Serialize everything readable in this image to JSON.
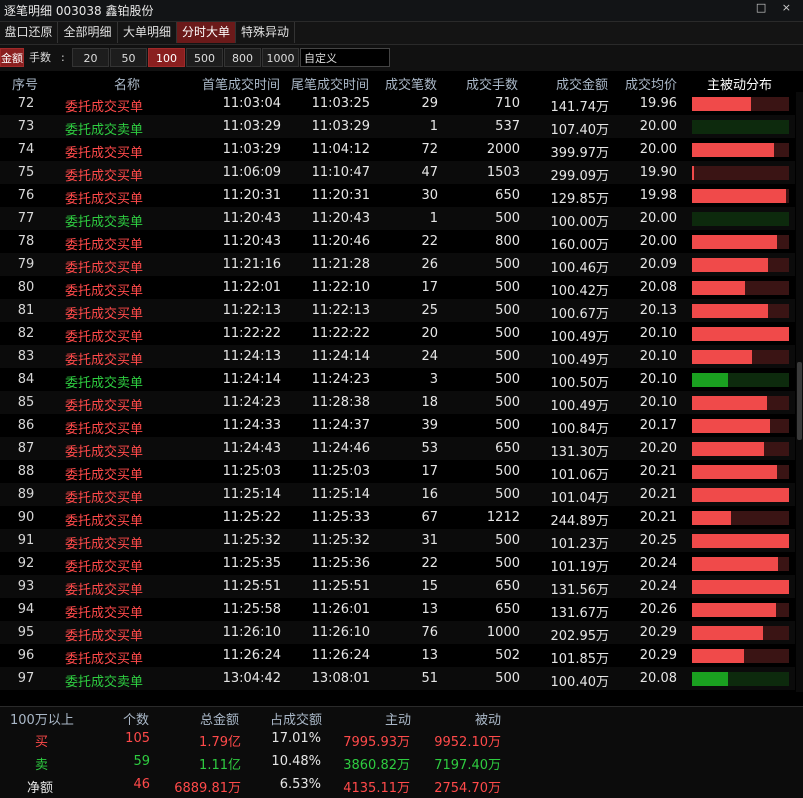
{
  "window": {
    "title": "逐笔明细 003038 鑫铂股份",
    "controls": "□ ×"
  },
  "tabs": [
    {
      "label": "盘口还原",
      "active": false
    },
    {
      "label": "全部明细",
      "active": false
    },
    {
      "label": "大单明细",
      "active": false
    },
    {
      "label": "分时大单",
      "active": true
    },
    {
      "label": "特殊异动",
      "active": false
    }
  ],
  "filter": {
    "amount_label": "金额",
    "lots_label": "手数",
    "colon": ":",
    "options": [
      "20",
      "50",
      "100",
      "500",
      "800",
      "1000"
    ],
    "selected": "100",
    "custom_value": "自定义"
  },
  "table": {
    "headers": {
      "no": "序号",
      "name": "名称",
      "first_time": "首笔成交时间",
      "last_time": "尾笔成交时间",
      "count": "成交笔数",
      "volume": "成交手数",
      "amount": "成交金额",
      "avg_price": "成交均价",
      "distribution": "主被动分布"
    },
    "rows": [
      {
        "no": "72",
        "name": "委托成交买单",
        "side": "buy",
        "first": "11:03:04",
        "last": "11:03:25",
        "count": "29",
        "vol": "710",
        "amt": "141.74万",
        "avg": "19.96",
        "active": 0.61
      },
      {
        "no": "73",
        "name": "委托成交卖单",
        "side": "sell",
        "first": "11:03:29",
        "last": "11:03:29",
        "count": "1",
        "vol": "537",
        "amt": "107.40万",
        "avg": "20.00",
        "active": 0.0
      },
      {
        "no": "74",
        "name": "委托成交买单",
        "side": "buy",
        "first": "11:03:29",
        "last": "11:04:12",
        "count": "72",
        "vol": "2000",
        "amt": "399.97万",
        "avg": "20.00",
        "active": 0.85
      },
      {
        "no": "75",
        "name": "委托成交买单",
        "side": "buy",
        "first": "11:06:09",
        "last": "11:10:47",
        "count": "47",
        "vol": "1503",
        "amt": "299.09万",
        "avg": "19.90",
        "active": 0.02
      },
      {
        "no": "76",
        "name": "委托成交买单",
        "side": "buy",
        "first": "11:20:31",
        "last": "11:20:31",
        "count": "30",
        "vol": "650",
        "amt": "129.85万",
        "avg": "19.98",
        "active": 0.97
      },
      {
        "no": "77",
        "name": "委托成交卖单",
        "side": "sell",
        "first": "11:20:43",
        "last": "11:20:43",
        "count": "1",
        "vol": "500",
        "amt": "100.00万",
        "avg": "20.00",
        "active": 0.0
      },
      {
        "no": "78",
        "name": "委托成交买单",
        "side": "buy",
        "first": "11:20:43",
        "last": "11:20:46",
        "count": "22",
        "vol": "800",
        "amt": "160.00万",
        "avg": "20.00",
        "active": 0.88
      },
      {
        "no": "79",
        "name": "委托成交买单",
        "side": "buy",
        "first": "11:21:16",
        "last": "11:21:28",
        "count": "26",
        "vol": "500",
        "amt": "100.46万",
        "avg": "20.09",
        "active": 0.78
      },
      {
        "no": "80",
        "name": "委托成交买单",
        "side": "buy",
        "first": "11:22:01",
        "last": "11:22:10",
        "count": "17",
        "vol": "500",
        "amt": "100.42万",
        "avg": "20.08",
        "active": 0.55
      },
      {
        "no": "81",
        "name": "委托成交买单",
        "side": "buy",
        "first": "11:22:13",
        "last": "11:22:13",
        "count": "25",
        "vol": "500",
        "amt": "100.67万",
        "avg": "20.13",
        "active": 0.78
      },
      {
        "no": "82",
        "name": "委托成交买单",
        "side": "buy",
        "first": "11:22:22",
        "last": "11:22:22",
        "count": "20",
        "vol": "500",
        "amt": "100.49万",
        "avg": "20.10",
        "active": 1.0
      },
      {
        "no": "83",
        "name": "委托成交买单",
        "side": "buy",
        "first": "11:24:13",
        "last": "11:24:14",
        "count": "24",
        "vol": "500",
        "amt": "100.49万",
        "avg": "20.10",
        "active": 0.62
      },
      {
        "no": "84",
        "name": "委托成交卖单",
        "side": "sell",
        "first": "11:24:14",
        "last": "11:24:23",
        "count": "3",
        "vol": "500",
        "amt": "100.50万",
        "avg": "20.10",
        "active": 0.37
      },
      {
        "no": "85",
        "name": "委托成交买单",
        "side": "buy",
        "first": "11:24:23",
        "last": "11:28:38",
        "count": "18",
        "vol": "500",
        "amt": "100.49万",
        "avg": "20.10",
        "active": 0.77
      },
      {
        "no": "86",
        "name": "委托成交买单",
        "side": "buy",
        "first": "11:24:33",
        "last": "11:24:37",
        "count": "39",
        "vol": "500",
        "amt": "100.84万",
        "avg": "20.17",
        "active": 0.8
      },
      {
        "no": "87",
        "name": "委托成交买单",
        "side": "buy",
        "first": "11:24:43",
        "last": "11:24:46",
        "count": "53",
        "vol": "650",
        "amt": "131.30万",
        "avg": "20.20",
        "active": 0.74
      },
      {
        "no": "88",
        "name": "委托成交买单",
        "side": "buy",
        "first": "11:25:03",
        "last": "11:25:03",
        "count": "17",
        "vol": "500",
        "amt": "101.06万",
        "avg": "20.21",
        "active": 0.88
      },
      {
        "no": "89",
        "name": "委托成交买单",
        "side": "buy",
        "first": "11:25:14",
        "last": "11:25:14",
        "count": "16",
        "vol": "500",
        "amt": "101.04万",
        "avg": "20.21",
        "active": 1.0
      },
      {
        "no": "90",
        "name": "委托成交买单",
        "side": "buy",
        "first": "11:25:22",
        "last": "11:25:33",
        "count": "67",
        "vol": "1212",
        "amt": "244.89万",
        "avg": "20.21",
        "active": 0.4
      },
      {
        "no": "91",
        "name": "委托成交买单",
        "side": "buy",
        "first": "11:25:32",
        "last": "11:25:32",
        "count": "31",
        "vol": "500",
        "amt": "101.23万",
        "avg": "20.25",
        "active": 1.0
      },
      {
        "no": "92",
        "name": "委托成交买单",
        "side": "buy",
        "first": "11:25:35",
        "last": "11:25:36",
        "count": "22",
        "vol": "500",
        "amt": "101.19万",
        "avg": "20.24",
        "active": 0.89
      },
      {
        "no": "93",
        "name": "委托成交买单",
        "side": "buy",
        "first": "11:25:51",
        "last": "11:25:51",
        "count": "15",
        "vol": "650",
        "amt": "131.56万",
        "avg": "20.24",
        "active": 1.0
      },
      {
        "no": "94",
        "name": "委托成交买单",
        "side": "buy",
        "first": "11:25:58",
        "last": "11:26:01",
        "count": "13",
        "vol": "650",
        "amt": "131.67万",
        "avg": "20.26",
        "active": 0.87
      },
      {
        "no": "95",
        "name": "委托成交买单",
        "side": "buy",
        "first": "11:26:10",
        "last": "11:26:10",
        "count": "76",
        "vol": "1000",
        "amt": "202.95万",
        "avg": "20.29",
        "active": 0.73
      },
      {
        "no": "96",
        "name": "委托成交买单",
        "side": "buy",
        "first": "11:26:24",
        "last": "11:26:24",
        "count": "13",
        "vol": "502",
        "amt": "101.85万",
        "avg": "20.29",
        "active": 0.54
      },
      {
        "no": "97",
        "name": "委托成交卖单",
        "side": "sell",
        "first": "13:04:42",
        "last": "13:08:01",
        "count": "51",
        "vol": "500",
        "amt": "100.40万",
        "avg": "20.08",
        "active": 0.37
      }
    ]
  },
  "summary": {
    "headers": {
      "range": "100万以上",
      "count": "个数",
      "total": "总金额",
      "ratio": "占成交额",
      "active": "主动",
      "passive": "被动"
    },
    "rows": [
      {
        "label": "买",
        "count": "105",
        "total": "1.79亿",
        "ratio": "17.01%",
        "active": "7995.93万",
        "passive": "9952.10万",
        "color": "red"
      },
      {
        "label": "卖",
        "count": "59",
        "total": "1.11亿",
        "ratio": "10.48%",
        "active": "3860.82万",
        "passive": "7197.40万",
        "color": "green"
      },
      {
        "label": "净额",
        "count": "46",
        "total": "6889.81万",
        "ratio": "6.53%",
        "active": "4135.11万",
        "passive": "2754.70万",
        "color": "mixed"
      }
    ]
  },
  "colors": {
    "buy": "#ff4a4a",
    "sell": "#2ecc40",
    "active_tab": "#6b1a1a",
    "selected_filter": "#8a1f1f"
  }
}
